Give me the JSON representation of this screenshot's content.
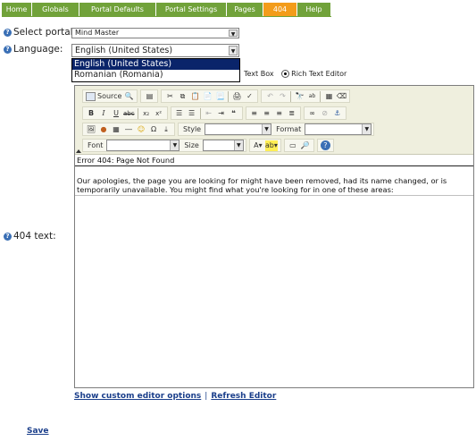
{
  "nav": {
    "tabs": [
      {
        "label": "Home",
        "active": false
      },
      {
        "label": "Globals",
        "active": false
      },
      {
        "label": "Portal Defaults",
        "active": false
      },
      {
        "label": "Portal Settings",
        "active": false
      },
      {
        "label": "Pages",
        "active": false
      },
      {
        "label": "404",
        "active": true
      },
      {
        "label": "Help",
        "active": false
      }
    ],
    "colors": {
      "tab": "#71a23a",
      "active": "#f39c1a"
    }
  },
  "form": {
    "portal_label": "Select portal:",
    "portal_value": "Mind Master",
    "language_label": "Language:",
    "language_value": "English (United States)",
    "language_options": [
      "English (United States)",
      "Romanian (Romania)"
    ],
    "text_box_label": "Text Box",
    "rich_text_label": "Rich Text Editor",
    "text_label": "404 text:"
  },
  "editor": {
    "toolbar": {
      "source_label": "Source",
      "style_label": "Style",
      "format_label": "Format",
      "font_label": "Font",
      "size_label": "Size"
    },
    "content": {
      "heading": "Error 404: Page Not Found",
      "paragraph": "Our apologies, the page you are looking for might have been removed, had its name changed, or is temporarily unavailable. You might find what you're looking for in one of these areas:"
    }
  },
  "links": {
    "custom_options": "Show custom editor options",
    "separator": "|",
    "refresh": "Refresh Editor"
  },
  "save_label": "Save"
}
